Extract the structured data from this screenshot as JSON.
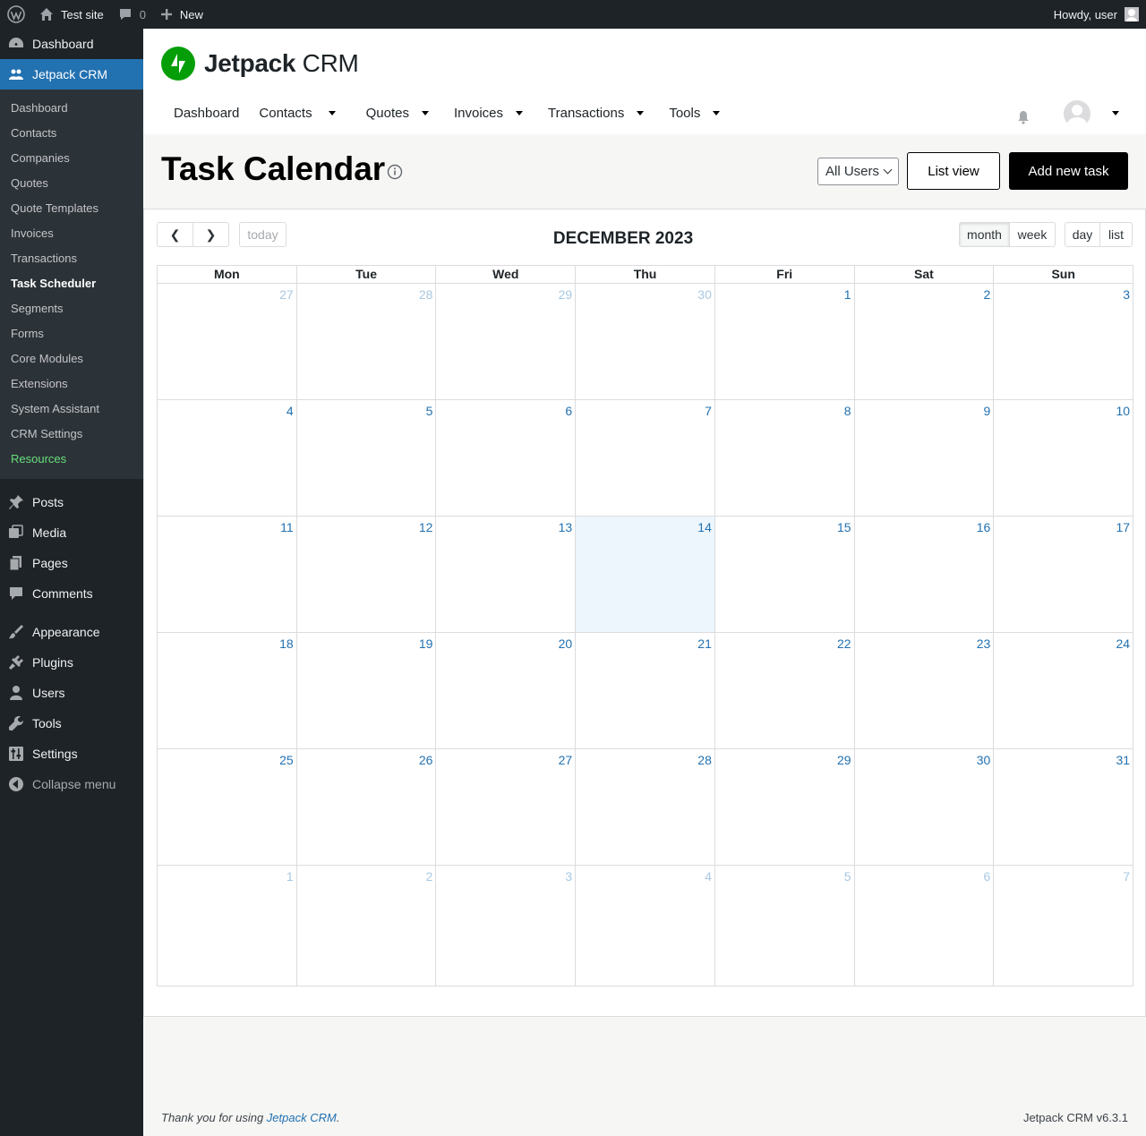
{
  "adminbar": {
    "site_name": "Test site",
    "comments_count": "0",
    "new_label": "New",
    "howdy": "Howdy, user"
  },
  "sidebar": {
    "top": [
      {
        "label": "Dashboard",
        "icon": "dashboard-icon"
      },
      {
        "label": "Jetpack CRM",
        "icon": "people-icon"
      }
    ],
    "submenu": [
      "Dashboard",
      "Contacts",
      "Companies",
      "Quotes",
      "Quote Templates",
      "Invoices",
      "Transactions",
      "Task Scheduler",
      "Segments",
      "Forms",
      "Core Modules",
      "Extensions",
      "System Assistant",
      "CRM Settings",
      "Resources"
    ],
    "bottom": [
      {
        "label": "Posts",
        "icon": "pin-icon"
      },
      {
        "label": "Media",
        "icon": "media-icon"
      },
      {
        "label": "Pages",
        "icon": "pages-icon"
      },
      {
        "label": "Comments",
        "icon": "comment-icon"
      },
      {
        "label": "Appearance",
        "icon": "brush-icon"
      },
      {
        "label": "Plugins",
        "icon": "plug-icon"
      },
      {
        "label": "Users",
        "icon": "user-icon"
      },
      {
        "label": "Tools",
        "icon": "wrench-icon"
      },
      {
        "label": "Settings",
        "icon": "sliders-icon"
      },
      {
        "label": "Collapse menu",
        "icon": "collapse-icon"
      }
    ]
  },
  "crm": {
    "logo_bold": "Jetpack",
    "logo_light": " CRM",
    "nav": [
      "Dashboard",
      "Contacts",
      "Quotes",
      "Invoices",
      "Transactions",
      "Tools"
    ]
  },
  "page": {
    "title": "Task Calendar",
    "user_filter": "All Users",
    "list_view": "List view",
    "add_task": "Add new task"
  },
  "calendar": {
    "prev": "❮",
    "next": "❯",
    "today": "today",
    "title": "DECEMBER 2023",
    "views": [
      "month",
      "week",
      "day",
      "list"
    ],
    "weekdays": [
      "Mon",
      "Tue",
      "Wed",
      "Thu",
      "Fri",
      "Sat",
      "Sun"
    ],
    "weeks": [
      [
        {
          "d": "27",
          "o": true
        },
        {
          "d": "28",
          "o": true
        },
        {
          "d": "29",
          "o": true
        },
        {
          "d": "30",
          "o": true
        },
        {
          "d": "1"
        },
        {
          "d": "2"
        },
        {
          "d": "3"
        }
      ],
      [
        {
          "d": "4"
        },
        {
          "d": "5"
        },
        {
          "d": "6"
        },
        {
          "d": "7"
        },
        {
          "d": "8"
        },
        {
          "d": "9"
        },
        {
          "d": "10"
        }
      ],
      [
        {
          "d": "11"
        },
        {
          "d": "12"
        },
        {
          "d": "13"
        },
        {
          "d": "14",
          "t": true
        },
        {
          "d": "15"
        },
        {
          "d": "16"
        },
        {
          "d": "17"
        }
      ],
      [
        {
          "d": "18"
        },
        {
          "d": "19"
        },
        {
          "d": "20"
        },
        {
          "d": "21"
        },
        {
          "d": "22"
        },
        {
          "d": "23"
        },
        {
          "d": "24"
        }
      ],
      [
        {
          "d": "25"
        },
        {
          "d": "26"
        },
        {
          "d": "27"
        },
        {
          "d": "28"
        },
        {
          "d": "29"
        },
        {
          "d": "30"
        },
        {
          "d": "31"
        }
      ],
      [
        {
          "d": "1",
          "o": true
        },
        {
          "d": "2",
          "o": true
        },
        {
          "d": "3",
          "o": true
        },
        {
          "d": "4",
          "o": true
        },
        {
          "d": "5",
          "o": true
        },
        {
          "d": "6",
          "o": true
        },
        {
          "d": "7",
          "o": true
        }
      ]
    ]
  },
  "footer": {
    "thanks_prefix": "Thank you for using ",
    "thanks_link": "Jetpack CRM",
    "thanks_suffix": ".",
    "version": "Jetpack CRM v6.3.1"
  },
  "colors": {
    "adminbar_bg": "#1d2327",
    "accent": "#2271b1",
    "jetpack_green": "#069e08",
    "today_bg": "#ecf6fc"
  }
}
